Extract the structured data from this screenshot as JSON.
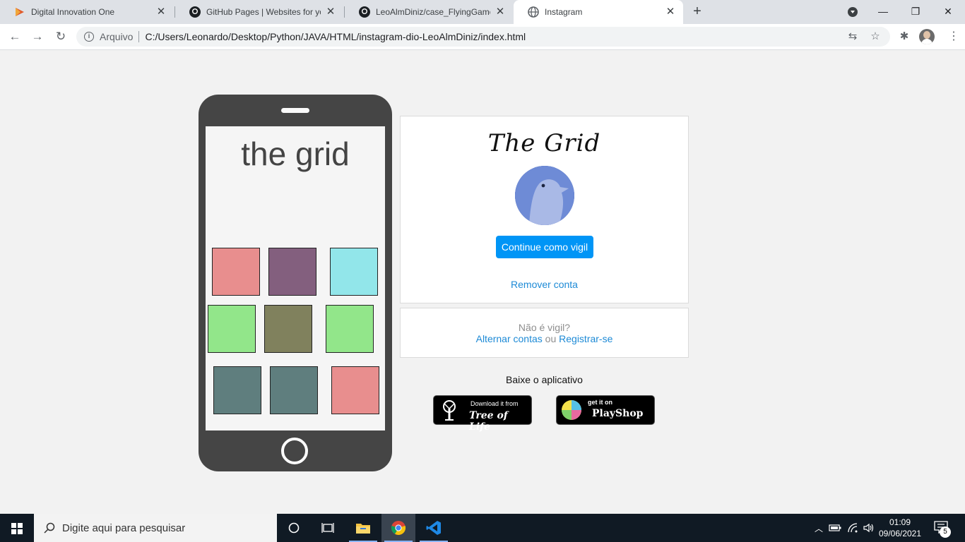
{
  "browser": {
    "tabs": [
      {
        "title": "Digital Innovation One",
        "favicon": "dio-logo-icon",
        "active": false
      },
      {
        "title": "GitHub Pages | Websites for you",
        "favicon": "github-icon",
        "active": false
      },
      {
        "title": "LeoAlmDiniz/case_FlyingGame: C",
        "favicon": "github-icon",
        "active": false
      },
      {
        "title": "Instagram",
        "favicon": "globe-icon",
        "active": true
      }
    ],
    "address": {
      "scheme_label": "Arquivo",
      "url": "C:/Users/Leonardo/Desktop/Python/JAVA/HTML/instagram-dio-LeoAlmDiniz/index.html"
    }
  },
  "phone": {
    "screen_title": "the grid",
    "squares": [
      {
        "color": "#e88e8e"
      },
      {
        "color": "#835f7e"
      },
      {
        "color": "#92e6ea"
      },
      {
        "color": "#92e68a"
      },
      {
        "color": "#80815d"
      },
      {
        "color": "#92e68a"
      },
      {
        "color": "#5f7e7e"
      },
      {
        "color": "#5f7e7e"
      },
      {
        "color": "#e88e8e"
      }
    ]
  },
  "login": {
    "logo_text": "The Grid",
    "continue_label": "Continue como vigil",
    "remove_label": "Remover conta"
  },
  "switch": {
    "question": "Não é vigil?",
    "switch_label": "Alternar contas",
    "or_label": "ou",
    "register_label": "Registrar-se"
  },
  "get_app": {
    "label": "Baixe o aplicativo",
    "badge_tree": {
      "small": "Download it from",
      "big": "Tree of Life"
    },
    "badge_play": {
      "small": "get it on",
      "big": "PlayShop"
    }
  },
  "taskbar": {
    "search_placeholder": "Digite aqui para pesquisar",
    "time": "01:09",
    "date": "09/06/2021",
    "notifications": "5"
  },
  "colors": {
    "accent": "#0095f6",
    "link": "#1d8ad6",
    "phone_body": "#454545"
  }
}
